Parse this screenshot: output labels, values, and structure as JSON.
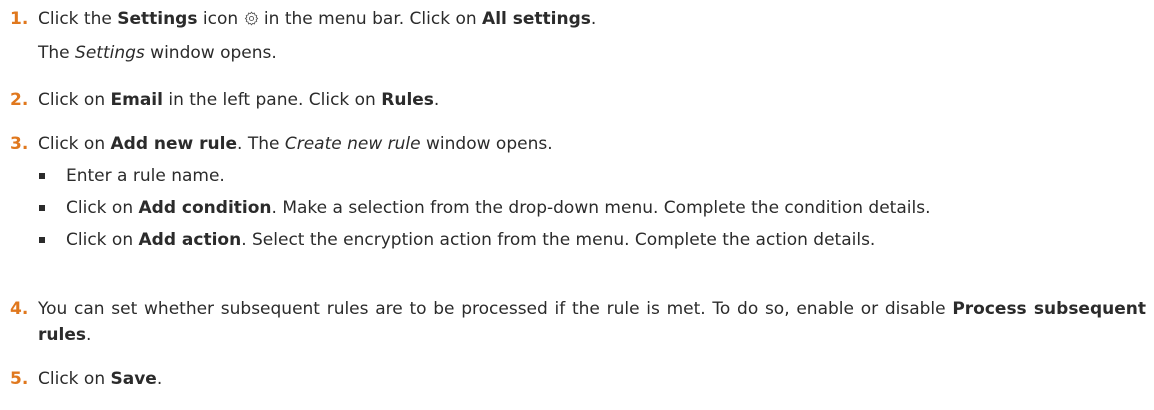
{
  "steps": [
    {
      "number": "1.",
      "parts": {
        "a": "Click the ",
        "b": "Settings",
        "c": " icon ",
        "d": " in the menu bar. Click on ",
        "e": "All settings",
        "f": "."
      },
      "line2": {
        "a": "The ",
        "b": "Settings",
        "c": " window opens."
      },
      "icon": "gear-icon"
    },
    {
      "number": "2.",
      "parts": {
        "a": "Click on ",
        "b": "Email",
        "c": " in the left pane. Click on ",
        "d": "Rules",
        "e": "."
      }
    },
    {
      "number": "3.",
      "parts": {
        "a": "Click on ",
        "b": "Add new rule",
        "c": ". The ",
        "d": "Create new rule",
        "e": " window opens."
      },
      "bullets": [
        {
          "a": "Enter a rule name."
        },
        {
          "a": "Click on ",
          "b": "Add condition",
          "c": ". Make a selection from the drop-down menu. Complete the condition details."
        },
        {
          "a": "Click on ",
          "b": "Add action",
          "c": ". Select the encryption action from the menu. Complete the action details."
        }
      ]
    },
    {
      "number": "4.",
      "parts": {
        "a": "You can set whether subsequent rules are to be processed if the rule is met. To do so, enable or disable ",
        "b": "Process subsequent rules",
        "c": "."
      }
    },
    {
      "number": "5.",
      "parts": {
        "a": "Click on ",
        "b": "Save",
        "c": "."
      }
    }
  ]
}
